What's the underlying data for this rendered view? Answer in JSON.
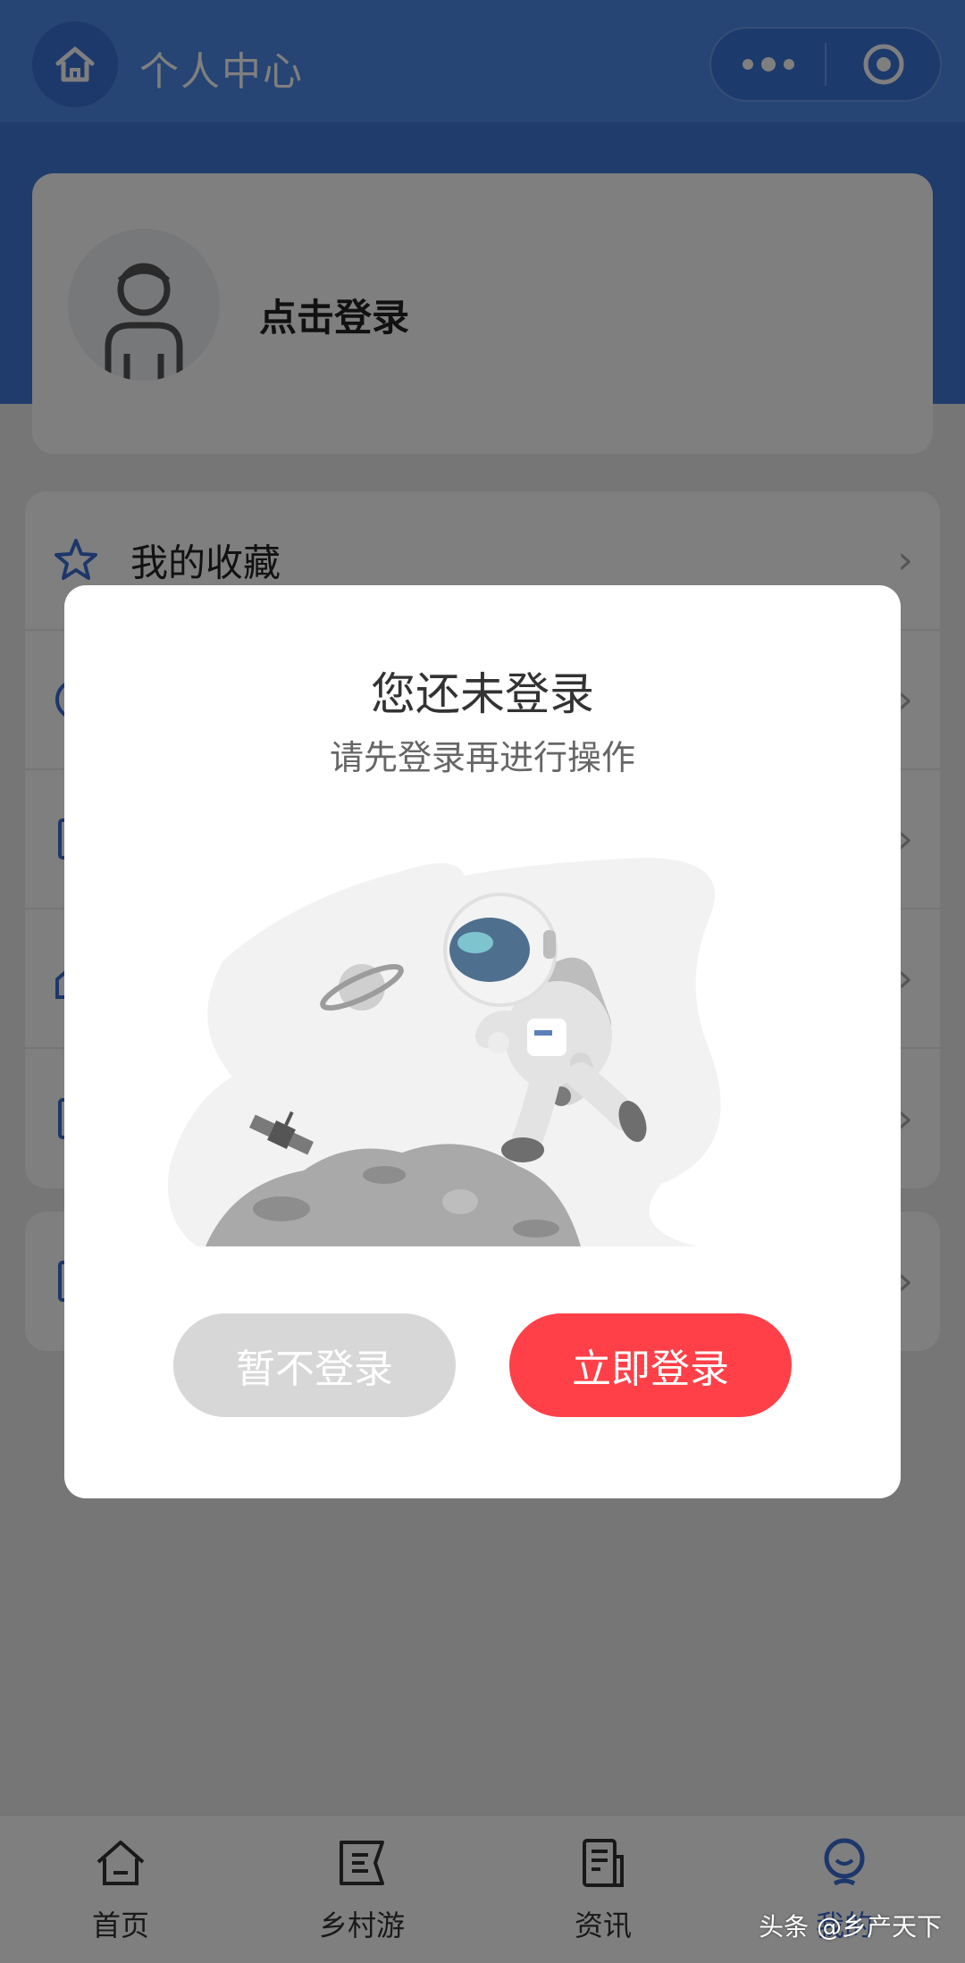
{
  "header": {
    "title": "个人中心"
  },
  "profile": {
    "login_prompt": "点击登录"
  },
  "menu": {
    "items": [
      {
        "label": "我的收藏",
        "icon": "star-icon"
      }
    ]
  },
  "tabbar": {
    "items": [
      {
        "label": "首页",
        "icon": "home-icon"
      },
      {
        "label": "乡村游",
        "icon": "flag-icon"
      },
      {
        "label": "资讯",
        "icon": "news-icon"
      },
      {
        "label": "我的",
        "icon": "user-icon"
      }
    ],
    "active_index": 3
  },
  "modal": {
    "title": "您还未登录",
    "subtitle": "请先登录再进行操作",
    "cancel_label": "暂不登录",
    "confirm_label": "立即登录"
  },
  "watermark": "头条 @乡产天下",
  "colors": {
    "header": "#4d88e8",
    "primary_button": "#ff4048",
    "secondary_button": "#d7d7d7",
    "active_tab": "#3b6fd6"
  }
}
